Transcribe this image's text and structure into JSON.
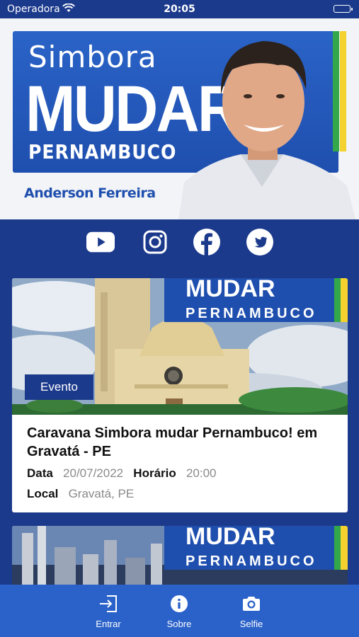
{
  "status_bar": {
    "carrier": "Operadora",
    "time": "20:05"
  },
  "hero": {
    "line1": "Simbora",
    "line2": "MUDAR",
    "line3": "PERNAMBUCO",
    "candidate": "Anderson Ferreira"
  },
  "social": [
    "youtube-icon",
    "instagram-icon",
    "facebook-icon",
    "twitter-icon"
  ],
  "events": [
    {
      "badge": "Evento",
      "banner_line1": "MUDAR",
      "banner_line2": "PERNAMBUCO",
      "title": "Caravana Simbora mudar Pernambuco! em Gravatá - PE",
      "date_label": "Data",
      "date": "20/07/2022",
      "time_label": "Horário",
      "time": "20:00",
      "place_label": "Local",
      "place": "Gravatá, PE"
    },
    {
      "banner_line1": "MUDAR",
      "banner_line2": "PERNAMBUCO"
    }
  ],
  "tabs": [
    {
      "label": "Entrar",
      "icon": "login-icon"
    },
    {
      "label": "Sobre",
      "icon": "info-icon"
    },
    {
      "label": "Selfie",
      "icon": "camera-icon"
    }
  ],
  "colors": {
    "navy": "#1c3a8c",
    "brand_blue": "#2b62c9",
    "yellow": "#f3d12e",
    "green": "#33a84a"
  }
}
